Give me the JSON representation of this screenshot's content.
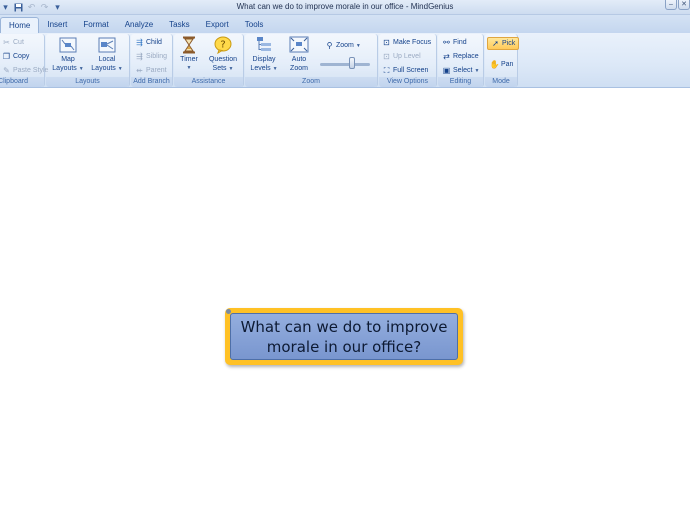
{
  "window": {
    "title": "What can we do to improve morale in our office - MindGenius",
    "controls": {
      "minimize": "–",
      "close": "✕"
    }
  },
  "qat": {
    "icons": [
      "app-menu-icon",
      "save-icon",
      "undo-icon",
      "redo-icon",
      "customize-icon"
    ]
  },
  "tabs": [
    {
      "label": "Home",
      "active": true
    },
    {
      "label": "Insert"
    },
    {
      "label": "Format"
    },
    {
      "label": "Analyze"
    },
    {
      "label": "Tasks"
    },
    {
      "label": "Export"
    },
    {
      "label": "Tools"
    }
  ],
  "ribbon": {
    "clipboard": {
      "label": "Clipboard",
      "cut": "Cut",
      "copy": "Copy",
      "paste_style": "Paste Style"
    },
    "layouts": {
      "label": "Layouts",
      "map_layouts": [
        "Map",
        "Layouts"
      ],
      "local_layouts": [
        "Local",
        "Layouts"
      ]
    },
    "add_branch": {
      "label": "Add Branch",
      "child": "Child",
      "sibling": "Sibling",
      "parent": "Parent"
    },
    "assistance": {
      "label": "Assistance",
      "timer": "Timer",
      "question_sets": [
        "Question",
        "Sets"
      ]
    },
    "zoom": {
      "label": "Zoom",
      "display_levels": [
        "Display",
        "Levels"
      ],
      "auto_zoom": [
        "Auto",
        "Zoom"
      ],
      "zoom": "Zoom"
    },
    "view_options": {
      "label": "View Options",
      "make_focus": "Make Focus",
      "up_level": "Up Level",
      "full_screen": "Full Screen"
    },
    "editing": {
      "label": "Editing",
      "find": "Find",
      "replace": "Replace",
      "select": "Select"
    },
    "mode": {
      "label": "Mode",
      "pick": "Pick",
      "pan": "Pan"
    }
  },
  "map": {
    "central_topic": {
      "line1": "What can we do to improve",
      "line2": "morale in our office?"
    },
    "colors": {
      "topic_border": "#ffc125",
      "topic_fill": "#8aa6da"
    }
  }
}
